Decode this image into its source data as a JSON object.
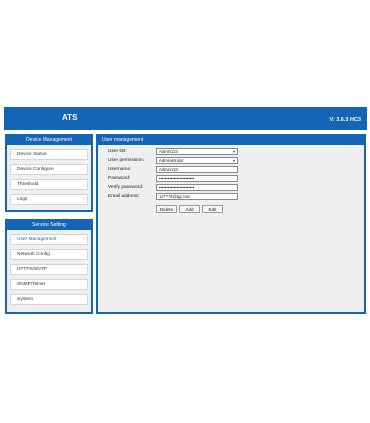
{
  "header": {
    "title": "ATS",
    "version": "V: 3.6.3 HC3"
  },
  "device_management": {
    "title": "Device Management",
    "items": [
      {
        "label": "Device Status"
      },
      {
        "label": "Device Configure"
      },
      {
        "label": "Threshold"
      },
      {
        "label": "Logs"
      }
    ]
  },
  "service_setting": {
    "title": "Service Setting",
    "items": [
      {
        "label": "User Management",
        "active": true
      },
      {
        "label": "Network Config"
      },
      {
        "label": "HTTPS/SNTP"
      },
      {
        "label": "SNMP/Telnet"
      },
      {
        "label": "System"
      }
    ]
  },
  "user_management": {
    "title": "User management",
    "fields": {
      "user_list": {
        "label": "User list:",
        "value": "Admin123"
      },
      "user_permission": {
        "label": "User permission:",
        "value": "Administrator"
      },
      "username": {
        "label": "Username:",
        "value": "Admin123"
      },
      "password": {
        "label": "Password:",
        "value": "••••••••••••••••••••••••"
      },
      "verify_password": {
        "label": "Verify password:",
        "value": "••••••••••••••••••••••••"
      },
      "email": {
        "label": "Email address:",
        "value": "12****9@qq.com"
      }
    },
    "buttons": {
      "delete": "Delete",
      "add": "Add",
      "edit": "Edit"
    }
  }
}
